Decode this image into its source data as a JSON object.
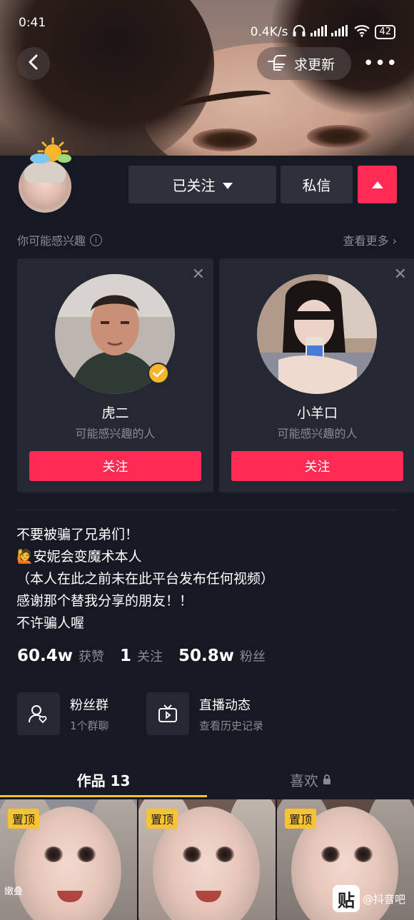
{
  "status_bar": {
    "time": "0:41",
    "speed": "0.4K/s",
    "battery": "42"
  },
  "header": {
    "update_label": "求更新",
    "more_label": "•••"
  },
  "actions": {
    "followed_label": "已关注",
    "message_label": "私信"
  },
  "suggestions": {
    "title": "你可能感兴趣",
    "see_more": "查看更多",
    "close_glyph": "✕",
    "items": [
      {
        "name": "虎二",
        "subtitle": "可能感兴趣的人",
        "follow_label": "关注",
        "verified": true
      },
      {
        "name": "小羊口",
        "subtitle": "可能感兴趣的人",
        "follow_label": "关注",
        "verified": false
      }
    ]
  },
  "bio": {
    "lines": [
      "不要被骗了兄弟们！",
      "🙋安妮会变魔术本人",
      "（本人在此之前未在此平台发布任何视频）",
      "感谢那个替我分享的朋友！！",
      "不许骗人喔"
    ]
  },
  "stats": [
    {
      "value": "60.4w",
      "label": "获赞"
    },
    {
      "value": "1",
      "label": "关注"
    },
    {
      "value": "50.8w",
      "label": "粉丝"
    }
  ],
  "features": [
    {
      "title": "粉丝群",
      "subtitle": "1个群聊",
      "icon": "fan-group-icon"
    },
    {
      "title": "直播动态",
      "subtitle": "查看历史记录",
      "icon": "live-tv-icon"
    }
  ],
  "tabs": {
    "works": "作品 13",
    "likes": "喜欢"
  },
  "videos": [
    {
      "pin_label": "置顶",
      "caption": "嫩叠"
    },
    {
      "pin_label": "置顶",
      "caption": ""
    },
    {
      "pin_label": "置顶",
      "caption": ""
    }
  ],
  "watermark": {
    "logo": "贴",
    "text": "@抖音吧"
  },
  "colors": {
    "accent": "#fe2c55",
    "background": "#161823",
    "card": "#252732",
    "highlight": "#f7c330"
  }
}
